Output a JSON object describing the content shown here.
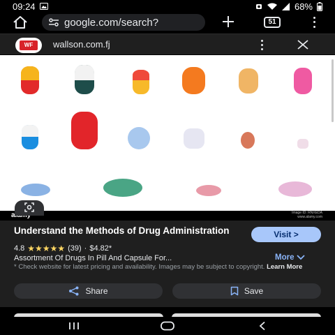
{
  "status_bar": {
    "time": "09:24",
    "battery": "68%"
  },
  "browser": {
    "url": "google.com/search?",
    "tab_count": "51"
  },
  "site": {
    "logo_text": "WF",
    "name": "wallson.com.fj"
  },
  "image": {
    "watermark_left": "alamy",
    "watermark_id": "Image ID: RNXEDA",
    "watermark_url": "www.alamy.com"
  },
  "result": {
    "title": "Understand the Methods of Drug Administration",
    "visit_label": "Visit >",
    "rating": "4.8",
    "stars": "★★★★★",
    "review_count": "(39)",
    "separator": "·",
    "price": "$4.82*",
    "subtitle": "Assortment Of Drugs In Pill And Capsule For...",
    "more_label": "More",
    "disclaimer": "* Check website for latest pricing and availability. Images may be subject to copyright.",
    "learn_more": "Learn More",
    "share_label": "Share",
    "save_label": "Save"
  },
  "colors": {
    "accent_blue": "#a8c7fa",
    "link_blue": "#8ab4f8",
    "star_yellow": "#fdd663",
    "panel_bg": "#1f1f1f",
    "button_bg": "#303134"
  },
  "icons": {
    "home": "home-icon",
    "site_settings": "tune-icon",
    "new_tab": "plus-icon",
    "tabs": "tabs-icon",
    "menu": "more-vert-icon",
    "close": "close-icon",
    "lens": "lens-icon",
    "share": "share-icon",
    "save": "bookmark-icon",
    "nav_recents": "recents-icon",
    "nav_home": "home-circle-icon",
    "nav_back": "back-icon"
  }
}
